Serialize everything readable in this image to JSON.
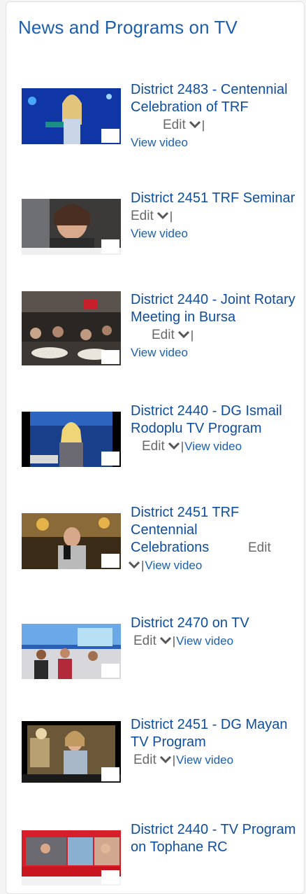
{
  "widget": {
    "title": "News and Programs on TV"
  },
  "common": {
    "edit_label": "Edit",
    "separator": "|",
    "view_video_label": "View video"
  },
  "items": [
    {
      "title": "District 2483 - Centennial Celebration of TRF"
    },
    {
      "title": "District 2451 TRF Seminar"
    },
    {
      "title": "District 2440 - Joint Rotary Meeting in Bursa"
    },
    {
      "title": "District 2440 - DG Ismail Rodoplu TV Program"
    },
    {
      "title": "District 2451 TRF Centennial Celebrations"
    },
    {
      "title": "District 2470 on TV"
    },
    {
      "title": "District 2451 - DG Mayan TV Program"
    },
    {
      "title": "District 2440 - TV Program on Tophane RC"
    }
  ],
  "icons": {
    "dropdown": "chevron-down-icon",
    "video_thumbnail": "video-thumbnail"
  },
  "colors": {
    "title": "#1b5fae",
    "link": "#0f4e9e",
    "muted": "#6a6a6a"
  }
}
